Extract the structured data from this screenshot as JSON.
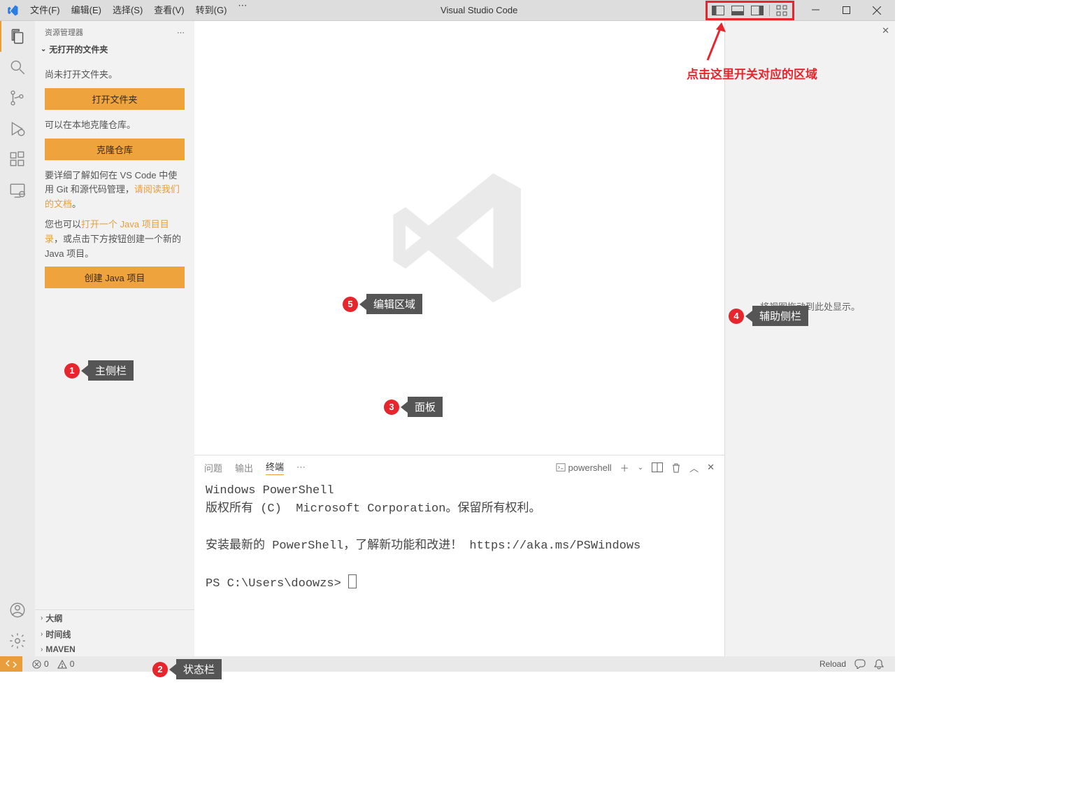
{
  "menubar": {
    "items": [
      "文件(F)",
      "编辑(E)",
      "选择(S)",
      "查看(V)",
      "转到(G)"
    ],
    "ellipsis": "⋯",
    "title": "Visual Studio Code"
  },
  "sidebar": {
    "header": "资源管理器",
    "more": "⋯",
    "section_title": "无打开的文件夹",
    "no_folder_text": "尚未打开文件夹。",
    "open_folder_btn": "打开文件夹",
    "clone_text": "可以在本地克隆仓库。",
    "clone_btn": "克隆仓库",
    "learn_prefix": "要详细了解如何在 VS Code 中使用 Git 和源代码管理，",
    "learn_link": "请阅读我们的文档",
    "learn_suffix": "。",
    "java_prefix": "您也可以",
    "java_link": "打开一个 Java 项目目录",
    "java_suffix": "，或点击下方按钮创建一个新的 Java 项目。",
    "create_java_btn": "创建 Java 项目",
    "collapsed": {
      "outline": "大纲",
      "timeline": "时间线",
      "maven": "MAVEN"
    }
  },
  "panel": {
    "tabs": {
      "problems": "问题",
      "output": "输出",
      "terminal": "终端",
      "more": "⋯"
    },
    "shell_label": "powershell",
    "terminal_lines": [
      "Windows PowerShell",
      "版权所有 (C)  Microsoft Corporation。保留所有权利。",
      "",
      "安装最新的 PowerShell，了解新功能和改进！ https://aka.ms/PSWindows",
      "",
      "PS C:\\Users\\doowzs> "
    ]
  },
  "secondary": {
    "drop_text": "将视图拖动到此处显示。"
  },
  "statusbar": {
    "errors": "0",
    "warnings": "0",
    "reload": "Reload"
  },
  "annotations": {
    "a1": "主侧栏",
    "a2": "状态栏",
    "a3": "面板",
    "a4": "辅助侧栏",
    "a5": "编辑区域",
    "red_hint": "点击这里开关对应的区域"
  }
}
